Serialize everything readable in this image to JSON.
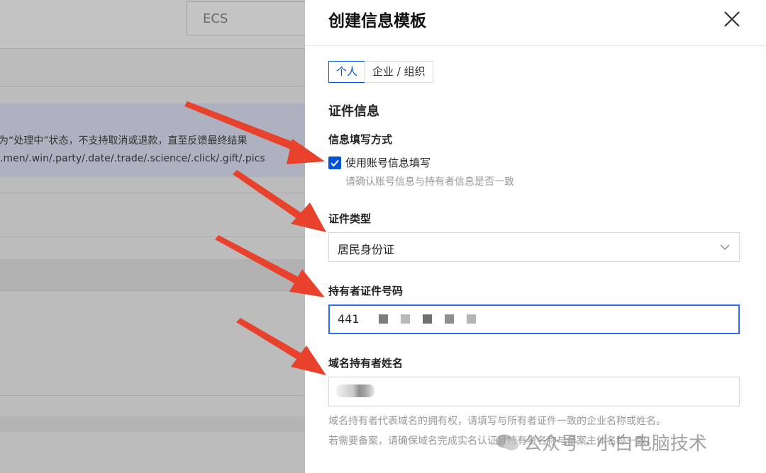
{
  "background": {
    "ecs_label": "ECS",
    "notice_line1": "为“处理中”状态，不支持取消或退款，直至反馈最终结果",
    "notice_line2": ".men/.win/.party/.date/.trade/.science/.click/.gift/.pics"
  },
  "drawer": {
    "title": "创建信息模板",
    "tabs": [
      {
        "label": "个人",
        "active": true
      },
      {
        "label": "企业 / 组织",
        "active": false
      }
    ],
    "section_title": "证件信息",
    "fill_method": {
      "label": "信息填写方式",
      "checkbox_label": "使用账号信息填写",
      "checked": true,
      "hint": "请确认账号信息与持有者信息是否一致"
    },
    "cert_type": {
      "label": "证件类型",
      "value": "居民身份证"
    },
    "cert_number": {
      "label": "持有者证件号码",
      "value": "441"
    },
    "holder_name": {
      "label": "域名持有者姓名",
      "desc_line1": "域名持有者代表域名的拥有权，请填写与所有者证件一致的企业名称或姓名。",
      "desc_line2": "若需要备案，请确保域名完成实名认证且持有者名称与备案主体名称一致。"
    }
  },
  "watermark": "公众号 · 小白电脑技术",
  "colors": {
    "accent": "#0052d9",
    "arrow": "#e8412c",
    "focus_border": "#2f6cf3"
  },
  "icons": [
    "close-icon",
    "check-icon",
    "chevron-down-icon",
    "wechat-icon",
    "arrow-icon"
  ]
}
